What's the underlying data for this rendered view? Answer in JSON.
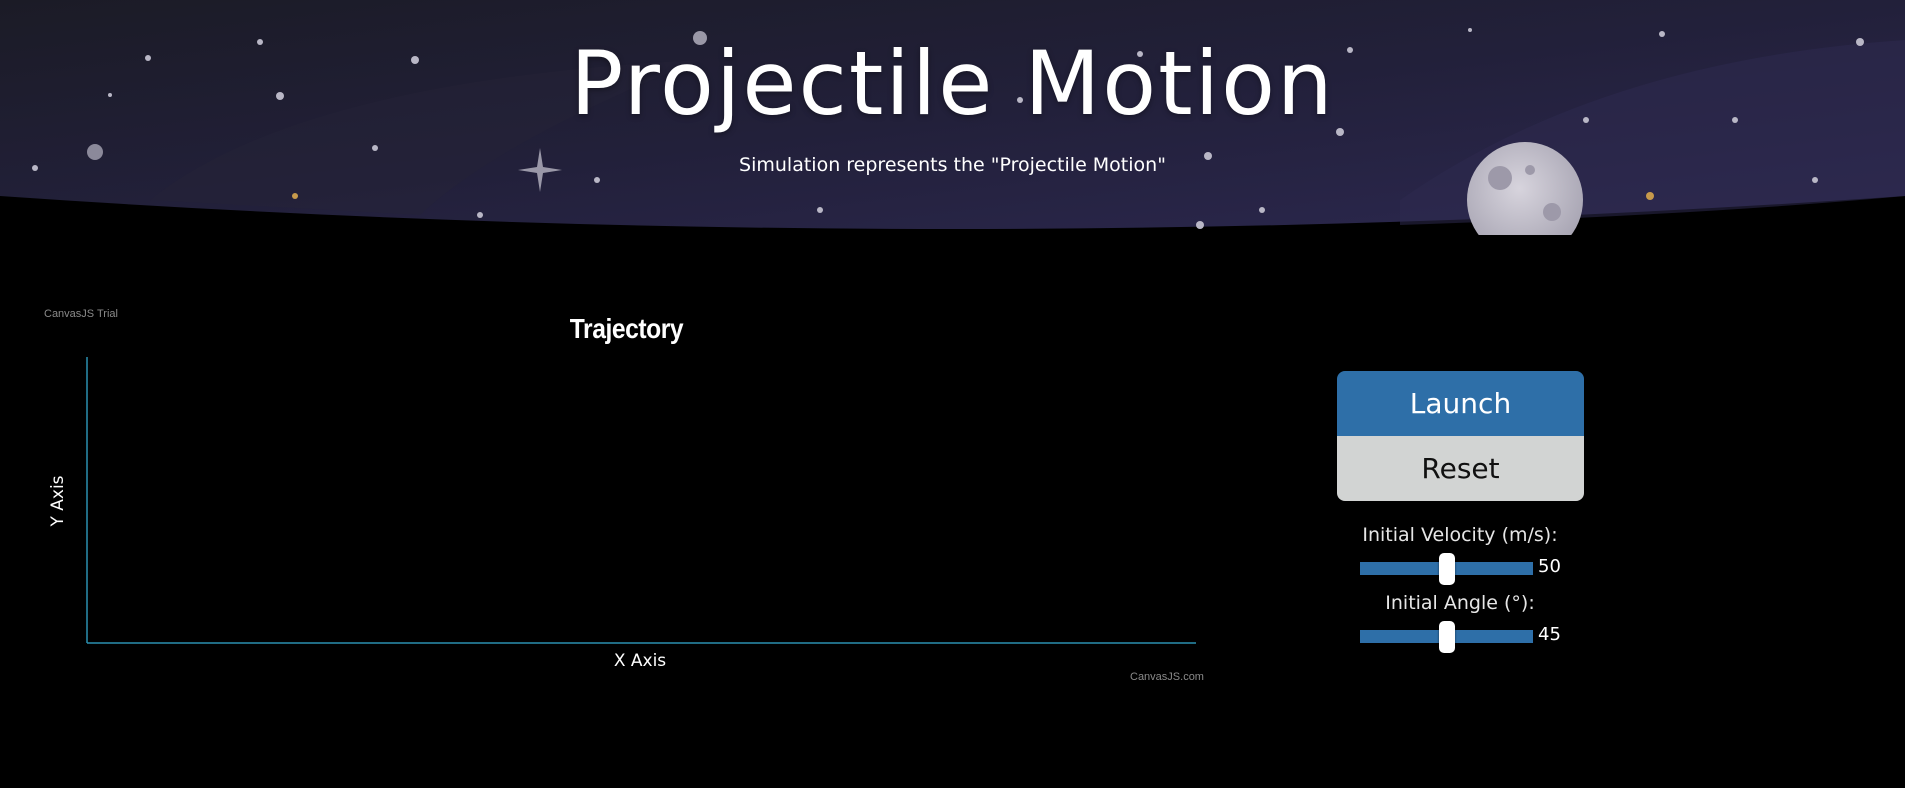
{
  "header": {
    "title": "Projectile Motion",
    "subtitle": "Simulation represents the \"Projectile Motion\""
  },
  "colors": {
    "page_background": "#000000",
    "banner_background": "#23213a",
    "accent_blue": "#2e6fa8",
    "reset_gray": "#d2d4d3",
    "axis_line": "#2a8fb0"
  },
  "icons": [
    "moon-icon",
    "sparkle-star-icon"
  ],
  "chart": {
    "trial_watermark": "CanvasJS Trial",
    "credit": "CanvasJS.com"
  },
  "chart_data": {
    "type": "line",
    "title": "Trajectory",
    "xlabel": "X Axis",
    "ylabel": "Y Axis",
    "series": [],
    "grid": false
  },
  "controls": {
    "launch_label": "Launch",
    "reset_label": "Reset",
    "velocity": {
      "label": "Initial Velocity (m/s):",
      "value": "50",
      "fraction": 0.5
    },
    "angle": {
      "label": "Initial Angle (°):",
      "value": "45",
      "fraction": 0.5
    }
  }
}
